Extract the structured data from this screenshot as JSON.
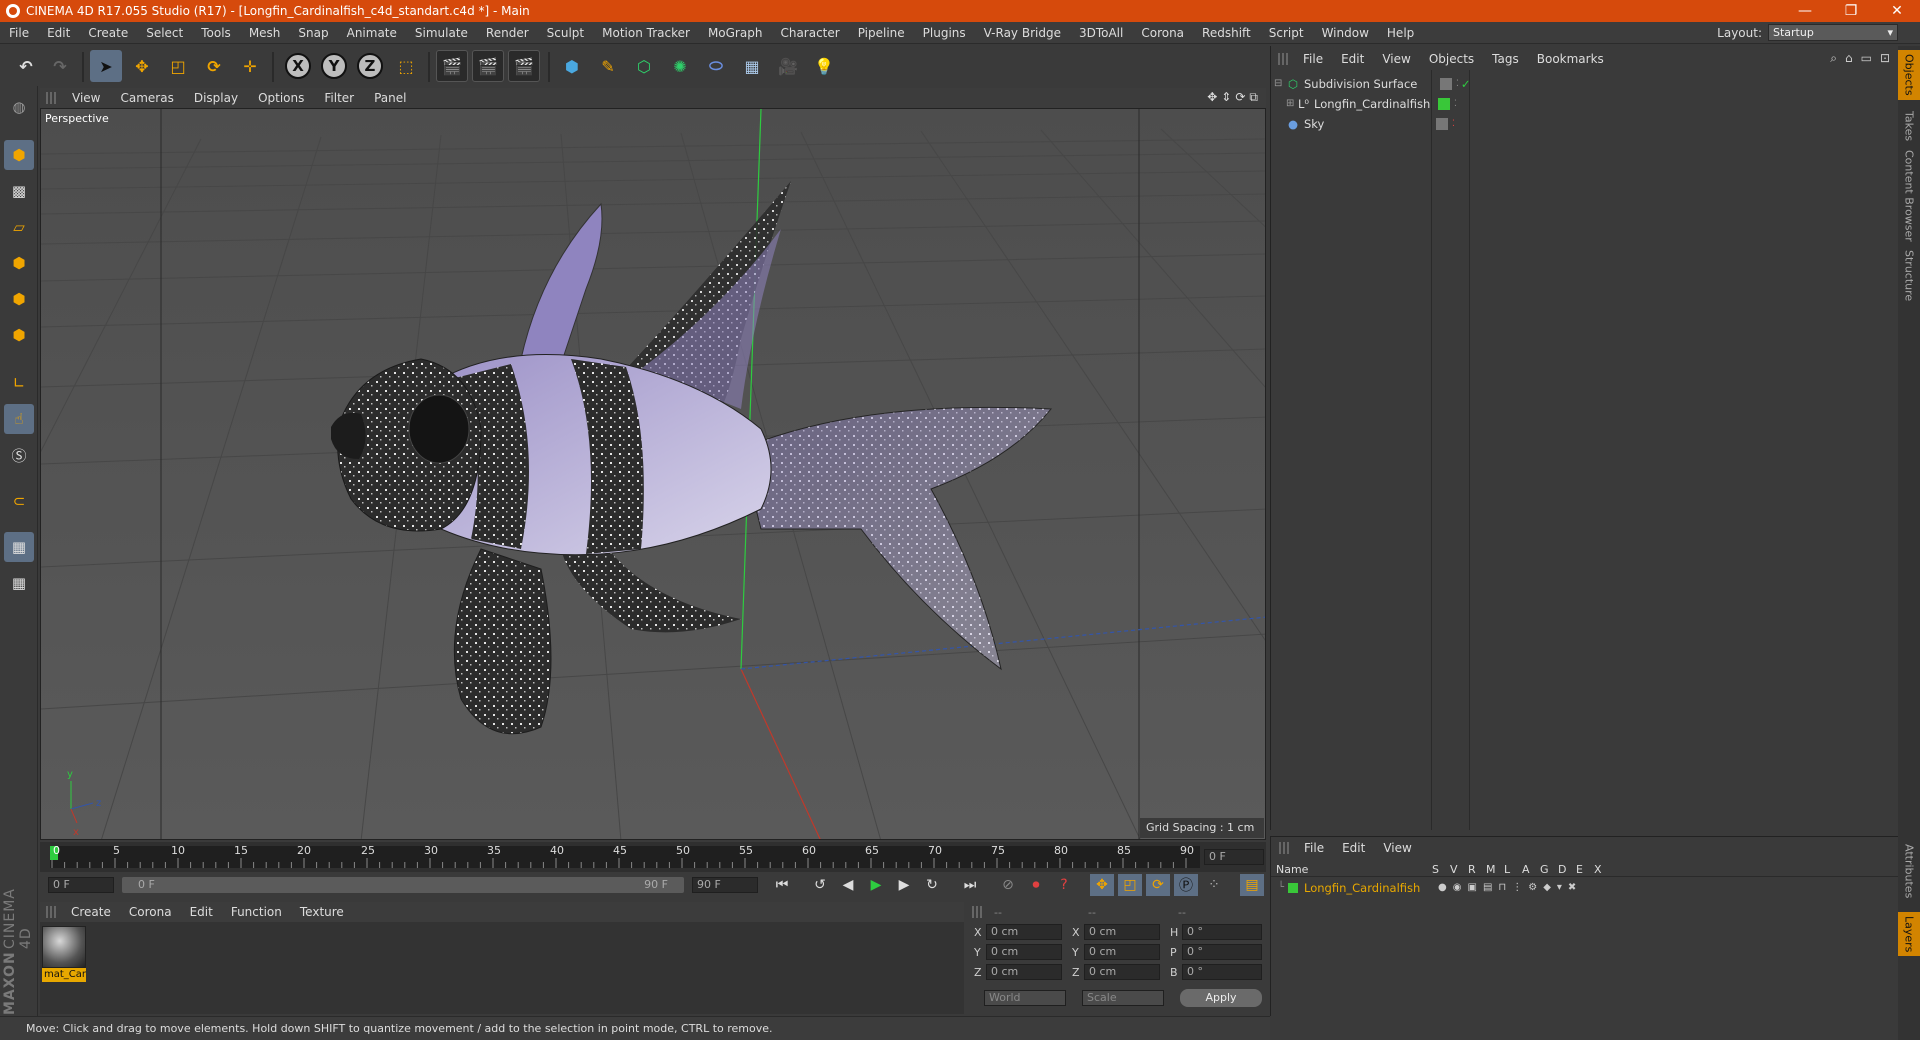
{
  "window": {
    "title": "CINEMA 4D R17.055 Studio (R17) - [Longfin_Cardinalfish_c4d_standart.c4d *] - Main",
    "minimize": "—",
    "restore": "❐",
    "close": "✕"
  },
  "menubar": {
    "items": [
      "File",
      "Edit",
      "Create",
      "Select",
      "Tools",
      "Mesh",
      "Snap",
      "Animate",
      "Simulate",
      "Render",
      "Sculpt",
      "Motion Tracker",
      "MoGraph",
      "Character",
      "Pipeline",
      "Plugins",
      "V-Ray Bridge",
      "3DToAll",
      "Corona",
      "Redshift",
      "Script",
      "Window",
      "Help"
    ],
    "layout_label": "Layout:",
    "layout_value": "Startup"
  },
  "toolbar": {
    "axis_x": "X",
    "axis_y": "Y",
    "axis_z": "Z"
  },
  "viewport": {
    "menu": [
      "View",
      "Cameras",
      "Display",
      "Options",
      "Filter",
      "Panel"
    ],
    "name": "Perspective",
    "grid_spacing": "Grid Spacing : 1 cm",
    "nav_icons": [
      "✥",
      "⇕",
      "⟳",
      "⧉"
    ]
  },
  "timeline": {
    "ticks": [
      "0",
      "5",
      "10",
      "15",
      "20",
      "25",
      "30",
      "35",
      "40",
      "45",
      "50",
      "55",
      "60",
      "65",
      "70",
      "75",
      "80",
      "85",
      "90"
    ],
    "current_frame": "0 F",
    "start_field": "0 F",
    "range_start": "0 F",
    "range_end": "90 F",
    "end_field": "90 F"
  },
  "material_manager": {
    "menu": [
      "Create",
      "Corona",
      "Edit",
      "Function",
      "Texture"
    ],
    "material_name": "mat_Car"
  },
  "coordinates": {
    "header": [
      "--",
      "--",
      "--"
    ],
    "rows": [
      {
        "a": "X",
        "av": "0 cm",
        "b": "X",
        "bv": "0 cm",
        "c": "H",
        "cv": "0 °"
      },
      {
        "a": "Y",
        "av": "0 cm",
        "b": "Y",
        "bv": "0 cm",
        "c": "P",
        "cv": "0 °"
      },
      {
        "a": "Z",
        "av": "0 cm",
        "b": "Z",
        "bv": "0 cm",
        "c": "B",
        "cv": "0 °"
      }
    ],
    "mode1": "World",
    "mode2": "Scale",
    "apply": "Apply"
  },
  "status": {
    "text": "Move: Click and drag to move elements. Hold down SHIFT to quantize movement / add to the selection in point mode, CTRL to remove."
  },
  "object_manager": {
    "menu": [
      "File",
      "Edit",
      "View",
      "Objects",
      "Tags",
      "Bookmarks"
    ],
    "objects": [
      {
        "name": "Subdivision Surface"
      },
      {
        "name": "Longfin_Cardinalfish"
      },
      {
        "name": "Sky"
      }
    ]
  },
  "layer_manager": {
    "menu": [
      "File",
      "Edit",
      "View"
    ],
    "columns": [
      "Name",
      "S",
      "V",
      "R",
      "M",
      "L",
      "A",
      "G",
      "D",
      "E",
      "X"
    ],
    "layer_name": "Longfin_Cardinalfish"
  },
  "right_tabs": [
    "Objects",
    "Takes",
    "Content Browser",
    "Structure",
    "Attributes",
    "Layers"
  ],
  "colors": {
    "title_bar": "#d64a0c",
    "selected_tool": "#5d6f85",
    "layer_name": "#e8a800",
    "active_tab": "#d28400"
  }
}
